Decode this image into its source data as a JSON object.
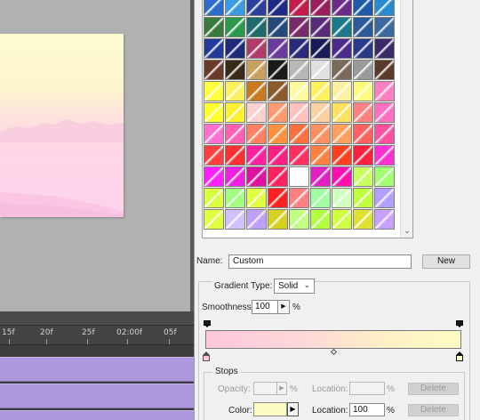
{
  "timeline": {
    "ticks": [
      "15f",
      "20f",
      "25f",
      "02:00f",
      "05f"
    ]
  },
  "presets": {
    "swatches": [
      [
        "#2a6cc8",
        "#3b9be0",
        "#2c3f9a",
        "#1f2a86",
        "#c41c4a",
        "#9b1d5e",
        "#6a2b8a",
        "#1f5aa8",
        "#2a8ad0"
      ],
      [
        "#3a7a3a",
        "#2a9a4a",
        "#1d6b6b",
        "#244a7a",
        "#7a2a6a",
        "#5a2a7a",
        "#1a7a8a",
        "#2a5a9a",
        "#3a6aa0"
      ],
      [
        "#223a9a",
        "#1f2a7a",
        "#b03a6a",
        "#6a3aa0",
        "#2a2a7a",
        "#1a1a5a",
        "#4a2a8a",
        "#2a3a8a",
        "#3a2a6a"
      ],
      [
        "#6a3a2a",
        "#3a2a1a",
        "#c8a060",
        "#1a1a1a",
        "#b8b8b8",
        "#e0e0e0",
        "#7a6a5a",
        "#9a9a9a",
        "#5a3a2a"
      ],
      [
        "#ffff40",
        "#fdf060",
        "#c87a20",
        "#8a5a2a",
        "#fffaa0",
        "#fff060",
        "#fdf0a0",
        "#fdfa80",
        "#ff80c0"
      ],
      [
        "#ffff30",
        "#fdf030",
        "#fdd0d0",
        "#fd9a70",
        "#ffc0c0",
        "#fdd0a0",
        "#ffe060",
        "#ff8080",
        "#ff70c0"
      ],
      [
        "#ff70d0",
        "#ff60b0",
        "#ff8060",
        "#ff9040",
        "#fd7040",
        "#fd9060",
        "#ffa060",
        "#ff6060",
        "#ff50a0"
      ],
      [
        "#ff4040",
        "#ff3030",
        "#ff20a0",
        "#fd2080",
        "#ff3060",
        "#ff8040",
        "#ff4020",
        "#ff2040",
        "#ff30d0"
      ],
      [
        "#ff20ff",
        "#f020e0",
        "#e010a0",
        "#ff2060",
        "#ffffff",
        "#e020c0",
        "#fd10b0",
        "#c8ff60",
        "#a0ff70"
      ],
      [
        "#d8ff40",
        "#a0ff80",
        "#e0ff40",
        "#ff2020",
        "#ff8080",
        "#a0ffa0",
        "#d0ffc0",
        "#c0ff40",
        "#b0a0ff"
      ],
      [
        "#e0ff40",
        "#d0c0ff",
        "#c0a0ff",
        "#d8d020",
        "#c0ff80",
        "#b0ff40",
        "#d0ff40",
        "#e0e030",
        "#c8a0ff"
      ]
    ],
    "scroll_down_icon": "chevron-down-icon"
  },
  "editor": {
    "name_label": "Name:",
    "name_value": "Custom",
    "new_button": "New",
    "gradient_type_label": "Gradient Type:",
    "gradient_type_value": "Solid",
    "smoothness_label": "Smoothness:",
    "smoothness_value": "100",
    "smoothness_unit": "%",
    "gradient_colors": [
      "#fdc6dc",
      "#fdfbc4"
    ],
    "stops_label": "Stops",
    "opacity_label": "Opacity:",
    "opacity_value": "",
    "opacity_unit": "%",
    "location_label": "Location:",
    "location_opacity_value": "",
    "location_opacity_unit": "%",
    "delete_label": "Delete",
    "color_label": "Color:",
    "color_value": "#fdfbc4",
    "location_color_value": "100",
    "location_color_unit": "%"
  }
}
